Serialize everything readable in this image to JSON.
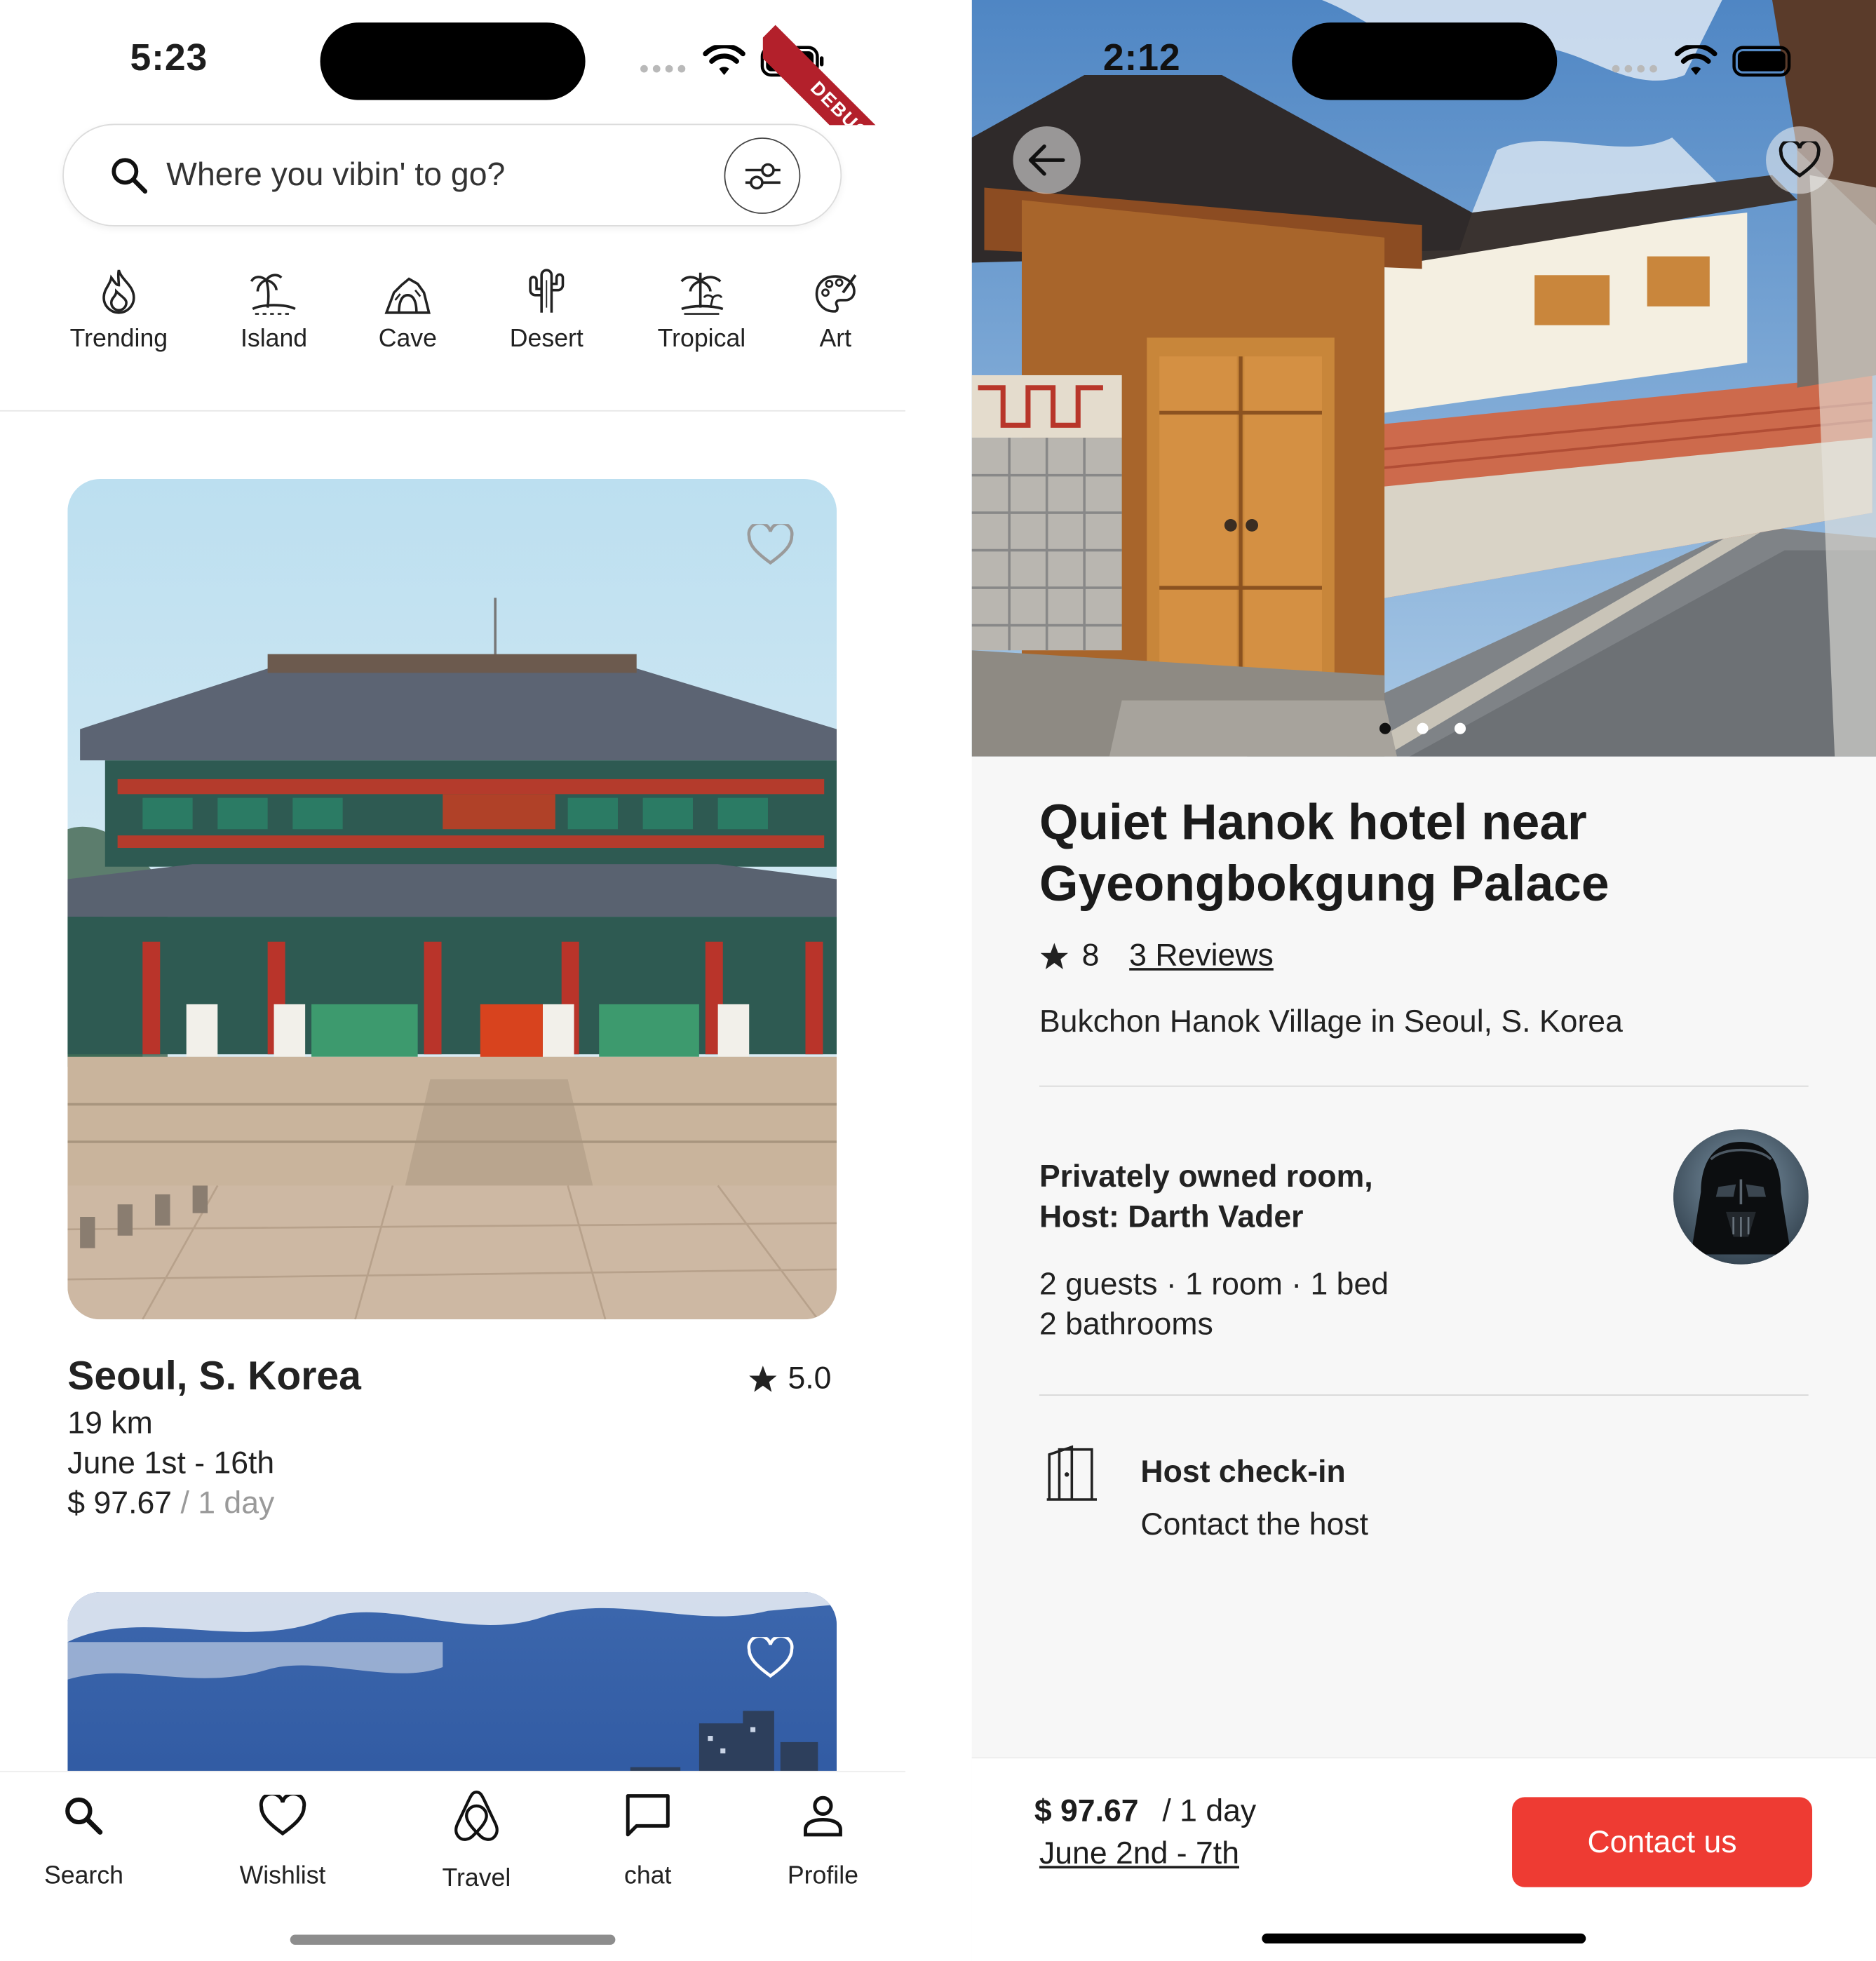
{
  "left_screen": {
    "status": {
      "time": "5:23"
    },
    "debug_ribbon": "DEBUG",
    "search": {
      "placeholder": "Where you vibin' to go?"
    },
    "categories": [
      {
        "label": "Trending",
        "icon": "flame-icon"
      },
      {
        "label": "Island",
        "icon": "island-icon"
      },
      {
        "label": "Cave",
        "icon": "cave-icon"
      },
      {
        "label": "Desert",
        "icon": "cactus-icon"
      },
      {
        "label": "Tropical",
        "icon": "palm-icon"
      },
      {
        "label": "Art",
        "icon": "palette-icon"
      }
    ],
    "listing": {
      "title": "Seoul, S. Korea",
      "rating": "5.0",
      "distance": "19 km",
      "dates": "June 1st - 16th",
      "price": "$ 97.67",
      "per": " / 1 day"
    },
    "nav": [
      {
        "label": "Search",
        "icon": "search-icon"
      },
      {
        "label": "Wishlist",
        "icon": "heart-icon"
      },
      {
        "label": "Travel",
        "icon": "airbnb-logo-icon"
      },
      {
        "label": "chat",
        "icon": "chat-icon"
      },
      {
        "label": "Profile",
        "icon": "person-icon"
      }
    ]
  },
  "right_screen": {
    "status": {
      "time": "2:12"
    },
    "title": "Quiet Hanok hotel near Gyeongbokgung Palace",
    "rating": "8",
    "reviews_link": "3 Reviews",
    "location": "Bukchon Hanok Village in Seoul, S. Korea",
    "host": {
      "line1": "Privately owned room,",
      "line2": "Host: Darth Vader"
    },
    "capacity": {
      "line1": "2 guests · 1 room · 1 bed",
      "line2": "2 bathrooms"
    },
    "checkin": {
      "title": "Host check-in",
      "subtitle": "Contact the host"
    },
    "booking": {
      "price": "$ 97.67",
      "per": "/ 1 day",
      "dates": "June 2nd - 7th",
      "cta": "Contact us"
    }
  },
  "colors": {
    "accent": "#ee3b33",
    "text": "#1d1d1d",
    "muted": "#9a9a9a"
  }
}
